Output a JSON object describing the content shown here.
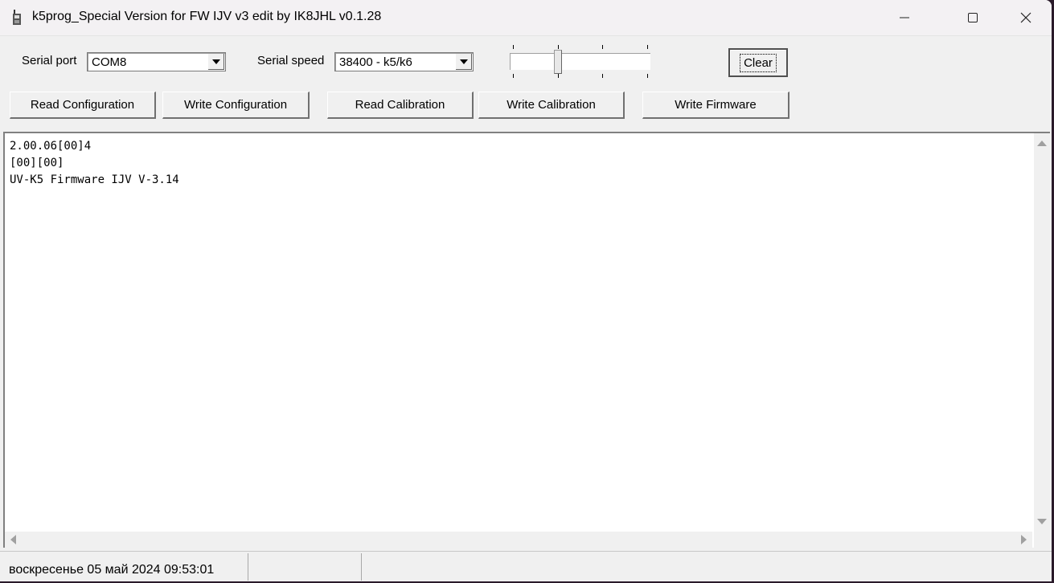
{
  "window": {
    "title": "k5prog_Special Version for FW IJV v3 edit by IK8JHL v0.1.28",
    "icon": "radio-icon"
  },
  "controls": {
    "serial_port_label": "Serial port",
    "serial_port_value": "COM8",
    "serial_speed_label": "Serial speed",
    "serial_speed_value": "38400 - k5/k6",
    "slider": {
      "min": 0,
      "max": 3,
      "value": 1
    },
    "clear_label": "Clear"
  },
  "buttons": [
    {
      "id": "read-configuration",
      "label": "Read Configuration"
    },
    {
      "id": "write-configuration",
      "label": "Write Configuration"
    },
    {
      "id": "read-calibration",
      "label": "Read Calibration"
    },
    {
      "id": "write-calibration",
      "label": "Write Calibration"
    },
    {
      "id": "write-firmware",
      "label": "Write Firmware"
    }
  ],
  "output": {
    "lines": [
      "2.00.06[00]4",
      "[00][00]",
      "UV-K5 Firmware IJV V-3.14"
    ]
  },
  "status": {
    "datetime": "воскресенье 05 май 2024  09:53:01"
  }
}
